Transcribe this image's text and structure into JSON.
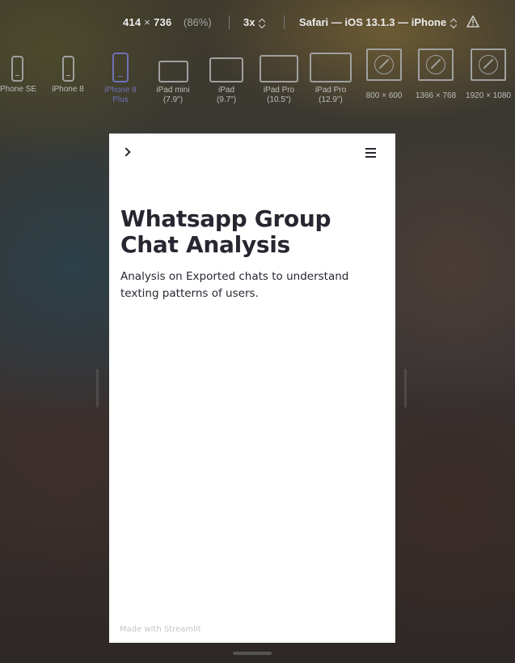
{
  "toolbar": {
    "width": "414",
    "times": "×",
    "height": "736",
    "percent": "(86%)",
    "scale": "3x",
    "browser": "Safari — iOS 13.1.3 — iPhone"
  },
  "devices": [
    {
      "label1": "Phone SE",
      "label2": "",
      "kind": "phone"
    },
    {
      "label1": "iPhone 8",
      "label2": "",
      "kind": "phone"
    },
    {
      "label1": "iPhone 8",
      "label2": "Plus",
      "kind": "phone",
      "active": true
    },
    {
      "label1": "iPad mini",
      "label2": "(7.9\")",
      "kind": "tablet"
    },
    {
      "label1": "iPad",
      "label2": "(9.7\")",
      "kind": "tablet"
    },
    {
      "label1": "iPad Pro",
      "label2": "(10.5\")",
      "kind": "tablet"
    },
    {
      "label1": "iPad Pro",
      "label2": "(12.9\")",
      "kind": "tablet"
    },
    {
      "label1": "800 × 600",
      "label2": "",
      "kind": "browser"
    },
    {
      "label1": "1366 × 768",
      "label2": "",
      "kind": "browser"
    },
    {
      "label1": "1920 × 1080",
      "label2": "",
      "kind": "browser"
    }
  ],
  "colors": {
    "accent": "#6f6fb9",
    "text": "#262730",
    "footer": "#c4c4c4"
  },
  "app": {
    "title": "Whatsapp Group Chat Analysis",
    "subtitle": "Analysis on Exported chats to understand texting patterns of users.",
    "footer": "Made with Streamlit",
    "icons": {
      "sidebar": "chevron-right-icon",
      "menu": "hamburger-menu-icon"
    }
  }
}
